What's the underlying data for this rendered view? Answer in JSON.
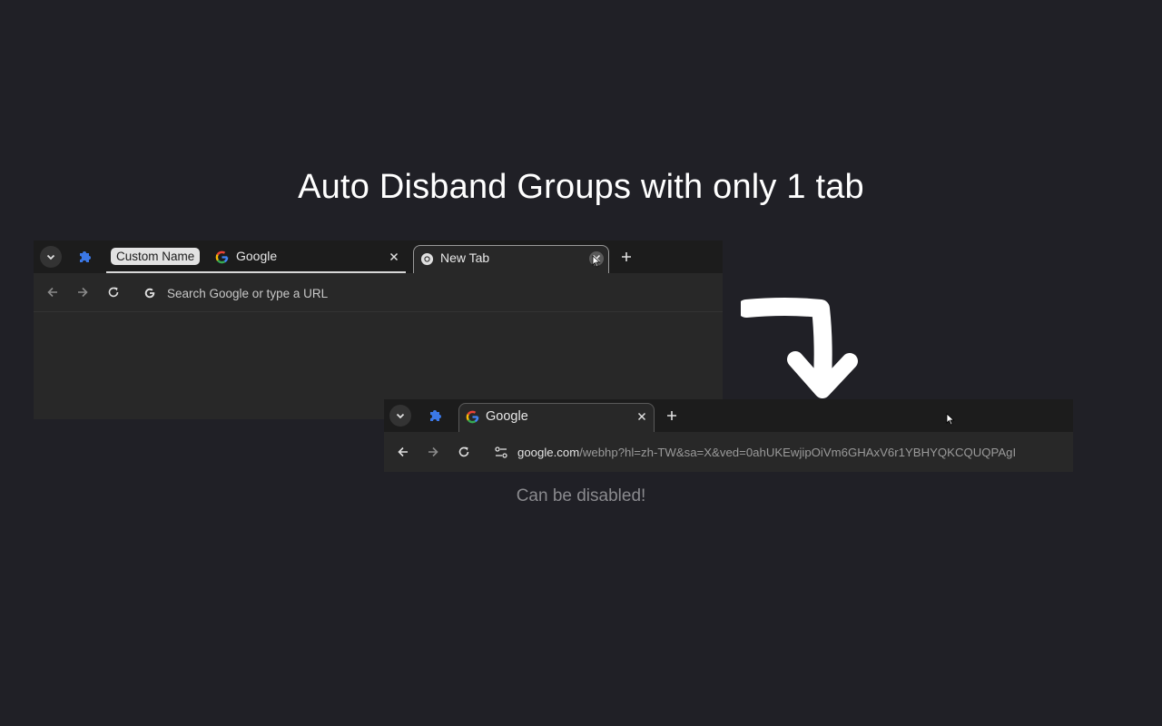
{
  "heading": "Auto Disband Groups with only 1 tab",
  "caption": "Can be disabled!",
  "before_window": {
    "group_label": "Custom Name",
    "tabs": [
      {
        "title": "Google",
        "favicon": "google-g-icon",
        "close": "✕"
      },
      {
        "title": "New Tab",
        "favicon": "chrome-icon",
        "close": "✕"
      }
    ],
    "omnibox_placeholder": "Search Google or type a URL"
  },
  "after_window": {
    "tabs": [
      {
        "title": "Google",
        "favicon": "google-g-icon",
        "close": "✕"
      }
    ],
    "url_host": "google.com",
    "url_rest": "/webhp?hl=zh-TW&sa=X&ved=0ahUKEwjipOiVm6GHAxV6r1YBHYQKCQUQPAgI"
  },
  "colors": {
    "background": "#202026",
    "tab_strip": "#1c1c1c",
    "toolbar": "#282828",
    "extension_blue": "#3b78e7",
    "group_chip": "#e2e2e2"
  }
}
